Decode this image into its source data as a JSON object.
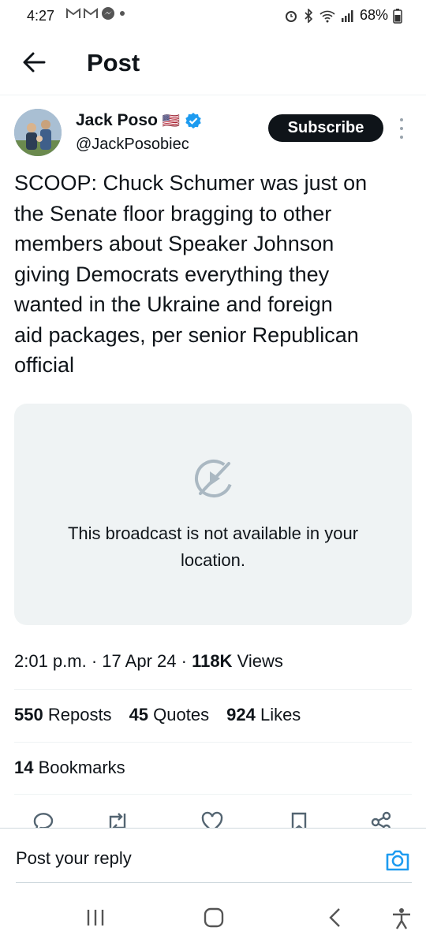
{
  "status_bar": {
    "time": "4:27",
    "battery": "68%",
    "left_icons": [
      "gmail-icon",
      "gmail-icon",
      "messenger-icon",
      "dot-icon"
    ],
    "right_icons": [
      "alarm-icon",
      "bluetooth-icon",
      "wifi-icon",
      "signal-icon",
      "battery-icon"
    ]
  },
  "header": {
    "title": "Post"
  },
  "author": {
    "name": "Jack Poso",
    "flag": "🇺🇸",
    "handle": "@JackPosobiec",
    "verified": true
  },
  "subscribe_label": "Subscribe",
  "tweet": {
    "text": "SCOOP: Chuck Schumer was just on\nthe Senate floor bragging to other\nmembers about Speaker Johnson\ngiving Democrats everything they\nwanted in the Ukraine and foreign\naid packages, per senior Republican\nofficial"
  },
  "media": {
    "message": "This broadcast is not available in your\nlocation."
  },
  "meta": {
    "time": "2:01 p.m.",
    "sep1": "·",
    "date": "17 Apr 24",
    "sep2": "·",
    "views_count": "118K",
    "views_label": "Views"
  },
  "stats": {
    "reposts_count": "550",
    "reposts_label": "Reposts",
    "quotes_count": "45",
    "quotes_label": "Quotes",
    "likes_count": "924",
    "likes_label": "Likes",
    "bookmarks_count": "14",
    "bookmarks_label": "Bookmarks"
  },
  "reply": {
    "placeholder": "Post your reply"
  },
  "colors": {
    "accent": "#1d9bf0",
    "text": "#0f1419",
    "muted": "#536471",
    "media_bg": "#eff3f4"
  }
}
